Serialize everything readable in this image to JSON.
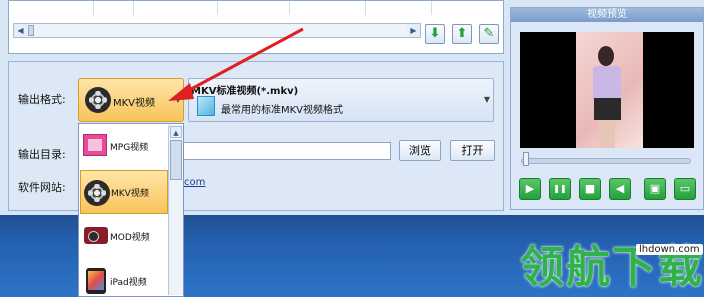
{
  "toolbar": {
    "down_icon_glyph": "⬇",
    "up_icon_glyph": "⬆",
    "edit_icon_glyph": "✎"
  },
  "settings": {
    "output_format_label": "输出格式:",
    "output_dir_label": "输出目录:",
    "website_label": "软件网站:",
    "selected_format": "MKV视频",
    "format_desc_title": "MKV标准视频(*.mkv)",
    "format_desc_sub": "最常用的标准MKV视频格式",
    "browse_button": "浏览",
    "open_button": "打开",
    "website_tail": "com"
  },
  "format_dropdown": {
    "items": [
      {
        "label": "MPG视频",
        "icon": "mpg-icon"
      },
      {
        "label": "MKV视频",
        "icon": "film-reel-icon",
        "selected": true
      },
      {
        "label": "MOD视频",
        "icon": "camcorder-icon"
      },
      {
        "label": "iPad视频",
        "icon": "ipad-icon"
      }
    ]
  },
  "preview": {
    "title": "视频预览",
    "controls": {
      "play": "▶",
      "pause": "❚❚",
      "stop": "■",
      "volume": "◀",
      "fullscreen": "▣",
      "folder": "▭"
    }
  },
  "watermark": {
    "text": "领航下载",
    "site": "lhdown.com",
    "color": "#2fb24a"
  },
  "colors": {
    "accent": "#f8c35a",
    "panel": "#dde8f6",
    "play_green": "#23a13c",
    "arrow_red": "#e02020"
  }
}
